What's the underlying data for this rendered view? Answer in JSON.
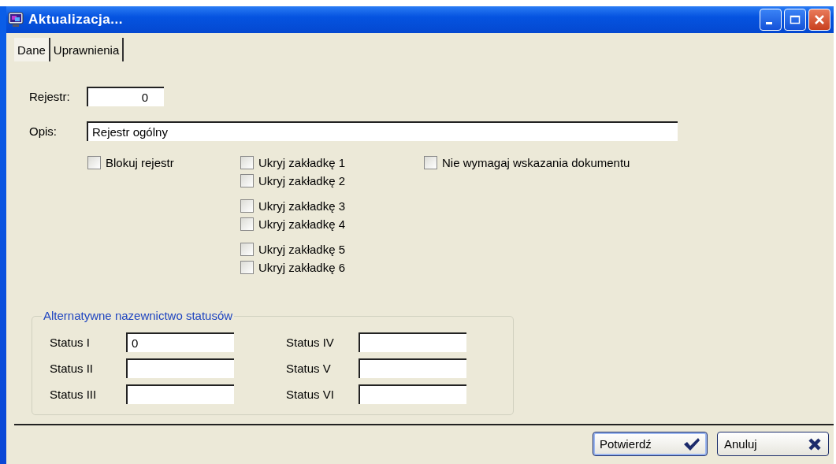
{
  "window": {
    "title": "Aktualizacja..."
  },
  "tabs": [
    {
      "label": "Dane",
      "selected": true
    },
    {
      "label": "Uprawnienia",
      "selected": false
    }
  ],
  "register": {
    "label": "Rejestr:",
    "value": "0"
  },
  "description": {
    "label": "Opis:",
    "value": "Rejestr ogólny"
  },
  "block_register": {
    "label": "Blokuj rejestr",
    "checked": false
  },
  "hide_tab_groups": [
    [
      {
        "label": "Ukryj zakładkę 1",
        "checked": false
      },
      {
        "label": "Ukryj zakładkę 2",
        "checked": false
      }
    ],
    [
      {
        "label": "Ukryj zakładkę 3",
        "checked": false
      },
      {
        "label": "Ukryj zakładkę 4",
        "checked": false
      }
    ],
    [
      {
        "label": "Ukryj zakładkę 5",
        "checked": false
      },
      {
        "label": "Ukryj zakładkę 6",
        "checked": false
      }
    ]
  ],
  "no_document": {
    "label": "Nie wymagaj wskazania dokumentu",
    "checked": false
  },
  "status_group": {
    "title": "Alternatywne nazewnictwo statusów",
    "columns": [
      [
        {
          "label": "Status I",
          "value": "0"
        },
        {
          "label": "Status II"
        },
        {
          "label": "Status III"
        }
      ],
      [
        {
          "label": "Status IV"
        },
        {
          "label": "Status V"
        },
        {
          "label": "Status VI"
        }
      ]
    ]
  },
  "buttons": [
    {
      "label": "Potwierdź",
      "kind": "confirm"
    },
    {
      "label": "Anuluj",
      "kind": "cancel"
    }
  ]
}
